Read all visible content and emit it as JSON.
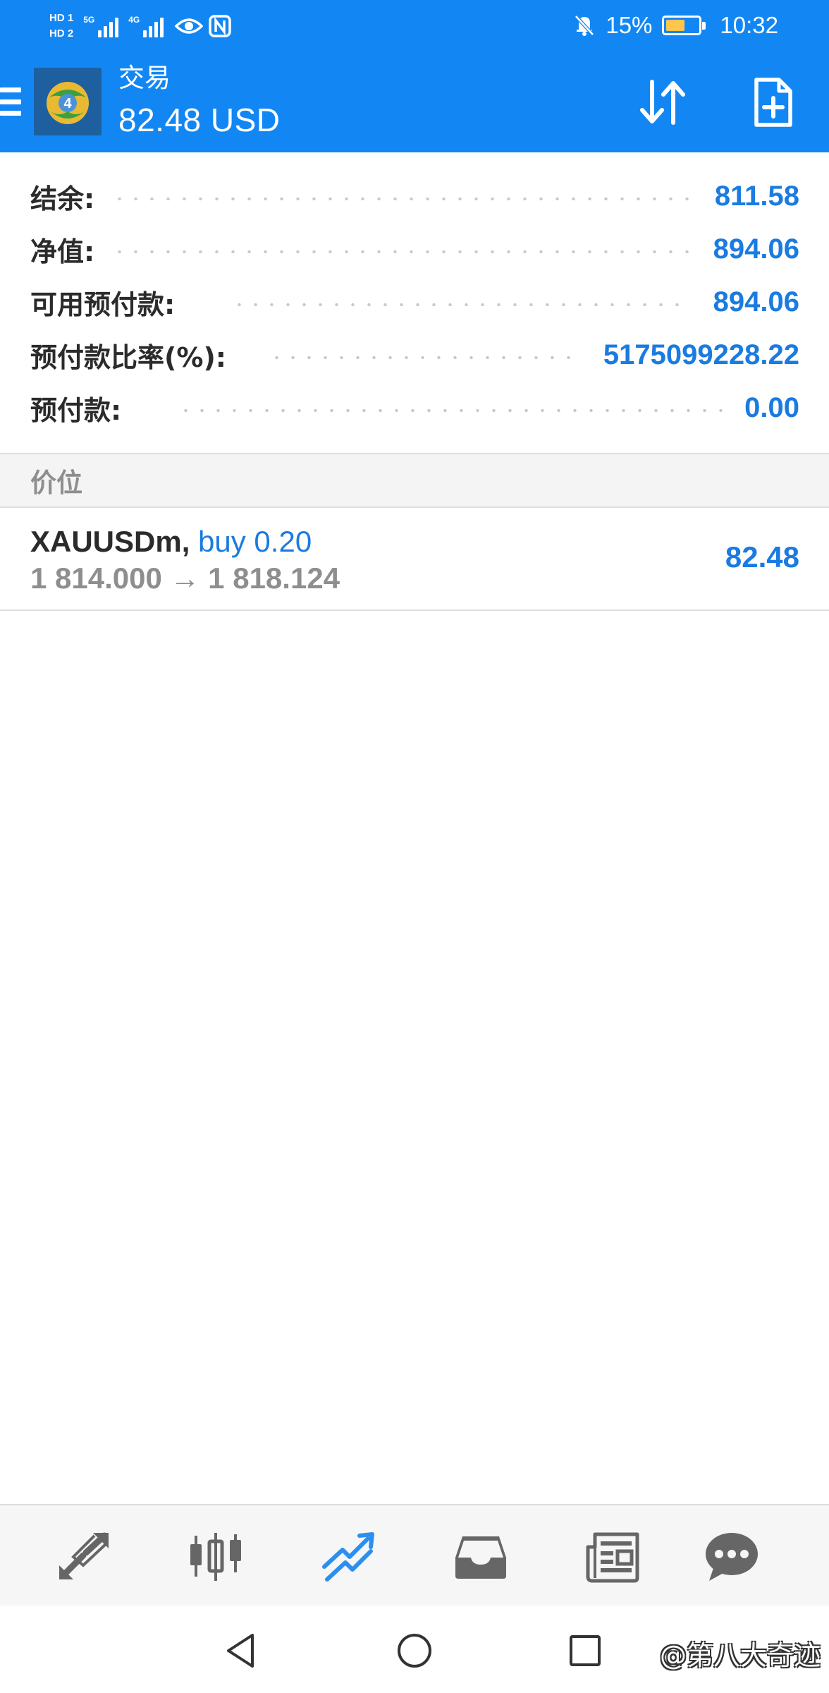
{
  "status_bar": {
    "hd1": "HD 1",
    "hd2": "HD 2",
    "net1": "5G",
    "net2": "4G",
    "battery": "15%",
    "time": "10:32"
  },
  "header": {
    "title": "交易",
    "subtitle": "82.48 USD",
    "accent_color": "#1287f4"
  },
  "summary": [
    {
      "label": "结余:",
      "value": "811.58"
    },
    {
      "label": "净值:",
      "value": "894.06"
    },
    {
      "label": "可用预付款:",
      "value": "894.06"
    },
    {
      "label": "预付款比率(%):",
      "value": "5175099228.22"
    },
    {
      "label": "预付款:",
      "value": "0.00"
    }
  ],
  "section": {
    "title": "价位"
  },
  "position": {
    "symbol": "XAUUSDm,",
    "direction": "buy 0.20",
    "prices": "1 814.000 → 1 818.124",
    "profit": "82.48"
  },
  "bottom_nav": [
    {
      "icon": "quotes-icon",
      "active": false
    },
    {
      "icon": "chart-icon",
      "active": false
    },
    {
      "icon": "trade-icon",
      "active": true
    },
    {
      "icon": "history-icon",
      "active": false
    },
    {
      "icon": "news-icon",
      "active": false
    },
    {
      "icon": "chat-icon",
      "active": false
    }
  ],
  "watermark": "@第八大奇迹"
}
